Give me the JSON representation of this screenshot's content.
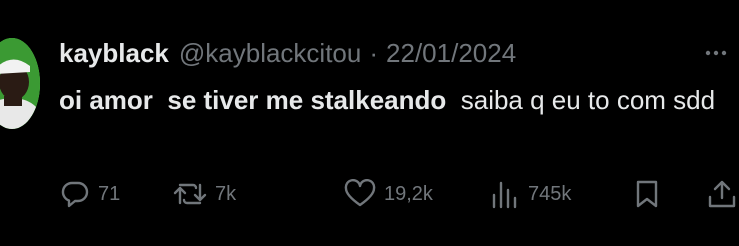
{
  "tweet": {
    "author": {
      "display_name": "kayblack",
      "handle": "@kayblackcitou",
      "avatar_icon": "profile-avatar"
    },
    "separator": "·",
    "date": "22/01/2024",
    "text_bold": "oi amor  se tiver me stalkeando",
    "text_regular": "  saiba q eu to com sdd",
    "more_icon": "more-options-icon"
  },
  "actions": {
    "reply": {
      "icon": "reply-icon",
      "count": "71"
    },
    "retweet": {
      "icon": "retweet-icon",
      "count": "7k"
    },
    "like": {
      "icon": "heart-icon",
      "count": "19,2k"
    },
    "views": {
      "icon": "views-icon",
      "count": "745k"
    },
    "bookmark": {
      "icon": "bookmark-icon"
    },
    "share": {
      "icon": "share-icon"
    }
  },
  "colors": {
    "background": "#000000",
    "text_primary": "#e7e9ea",
    "text_secondary": "#71767b",
    "avatar_ring": "#52c94a"
  }
}
